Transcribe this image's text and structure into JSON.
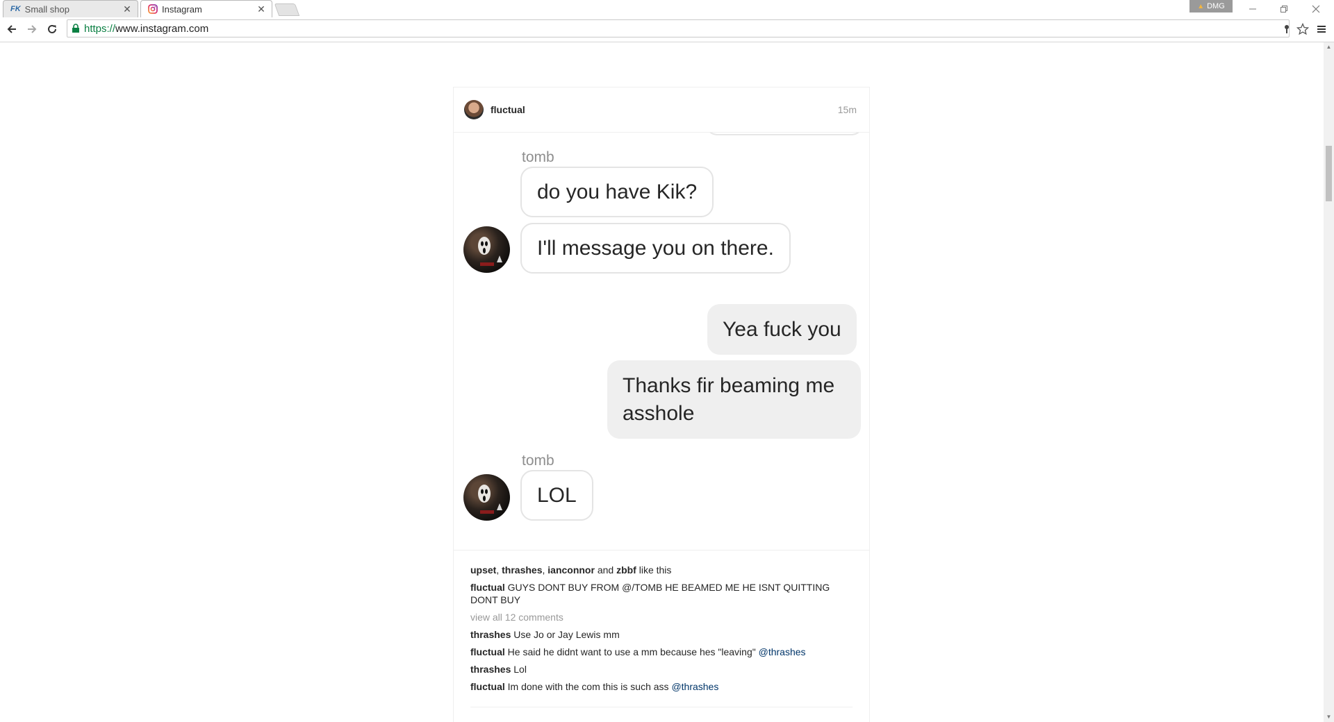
{
  "browser": {
    "tabs": [
      {
        "favicon": "FK",
        "title": "Small shop",
        "close": "✕"
      },
      {
        "favicon": "instagram-icon",
        "title": "Instagram",
        "close": "✕"
      }
    ],
    "profile_label": "DMG",
    "url_scheme": "https://",
    "url_host": "www.instagram.com"
  },
  "post": {
    "username": "fluctual",
    "time": "15m",
    "messages": [
      {
        "sender": "tomb"
      },
      {
        "text": "do you have Kik?",
        "direction": "in"
      },
      {
        "text": "I'll message you on there.",
        "direction": "in"
      },
      {
        "text": "Yea fuck you",
        "direction": "out"
      },
      {
        "text": "Thanks fir beaming me asshole",
        "direction": "out"
      },
      {
        "sender": "tomb"
      },
      {
        "text": "LOL",
        "direction": "in"
      }
    ],
    "sender_name": "tomb",
    "likes": {
      "users": [
        "upset",
        "thrashes",
        "ianconnor"
      ],
      "and_label": "and",
      "last_user": "zbbf",
      "suffix": "like this"
    },
    "caption": {
      "user": "fluctual",
      "text": "GUYS DONT BUY FROM @/TOMB HE BEAMED ME HE ISNT QUITTING DONT BUY"
    },
    "view_all": "view all 12 comments",
    "comments": [
      {
        "user": "thrashes",
        "text": "Use Jo or Jay Lewis mm",
        "mention": ""
      },
      {
        "user": "fluctual",
        "text": "He said he didnt want to use a mm because hes \"leaving\"",
        "mention": "@thrashes"
      },
      {
        "user": "thrashes",
        "text": "Lol",
        "mention": ""
      },
      {
        "user": "fluctual",
        "text": "Im done with the com this is such ass",
        "mention": "@thrashes"
      }
    ]
  }
}
